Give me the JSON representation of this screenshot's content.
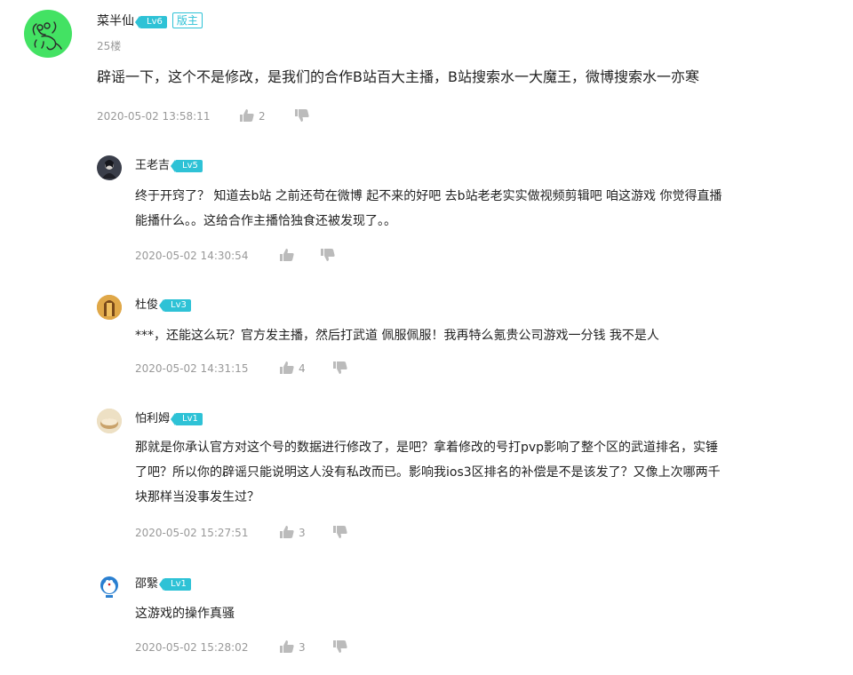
{
  "main_comment": {
    "username": "菜半仙",
    "level": "Lv6",
    "badge": "版主",
    "floor": "25楼",
    "text": "辟谣一下，这个不是修改，是我们的合作B站百大主播，B站搜索水一大魔王，微博搜索水一亦寒",
    "time": "2020-05-02 13:58:11",
    "likes": "2"
  },
  "replies": [
    {
      "username": "王老吉",
      "level": "Lv5",
      "text_lines": [
        "终于开窍了？ 知道去b站 之前还苟在微博 起不来的好吧 去b站老老实实做视频剪辑吧 咱这游戏 你觉得直播",
        "能播什么。。这给合作主播恰独食还被发现了。。"
      ],
      "time": "2020-05-02 14:30:54",
      "likes": ""
    },
    {
      "username": "杜俊",
      "level": "Lv3",
      "text_lines": [
        "***，还能这么玩？官方发主播，然后打武道 佩服佩服！我再特么氪贵公司游戏一分钱 我不是人"
      ],
      "time": "2020-05-02 14:31:15",
      "likes": "4"
    },
    {
      "username": "怕利姆",
      "level": "Lv1",
      "text_lines": [
        "那就是你承认官方对这个号的数据进行修改了，是吧？拿着修改的号打pvp影响了整个区的武道排名，实锤",
        "了吧？所以你的辟谣只能说明这人没有私改而已。影响我ios3区排名的补偿是不是该发了？又像上次哪两千",
        "块那样当没事发生过？"
      ],
      "time": "2020-05-02 15:27:51",
      "likes": "3"
    },
    {
      "username": "邵繄",
      "level": "Lv1",
      "text_lines": [
        "这游戏的操作真骚"
      ],
      "time": "2020-05-02 15:28:02",
      "likes": "3"
    }
  ],
  "icons": {
    "like": "thumbs-up-icon",
    "dislike": "thumbs-down-icon"
  },
  "colors": {
    "accent": "#2ec2d6",
    "avatar_green": "#43e263",
    "meta_gray": "#999999"
  }
}
